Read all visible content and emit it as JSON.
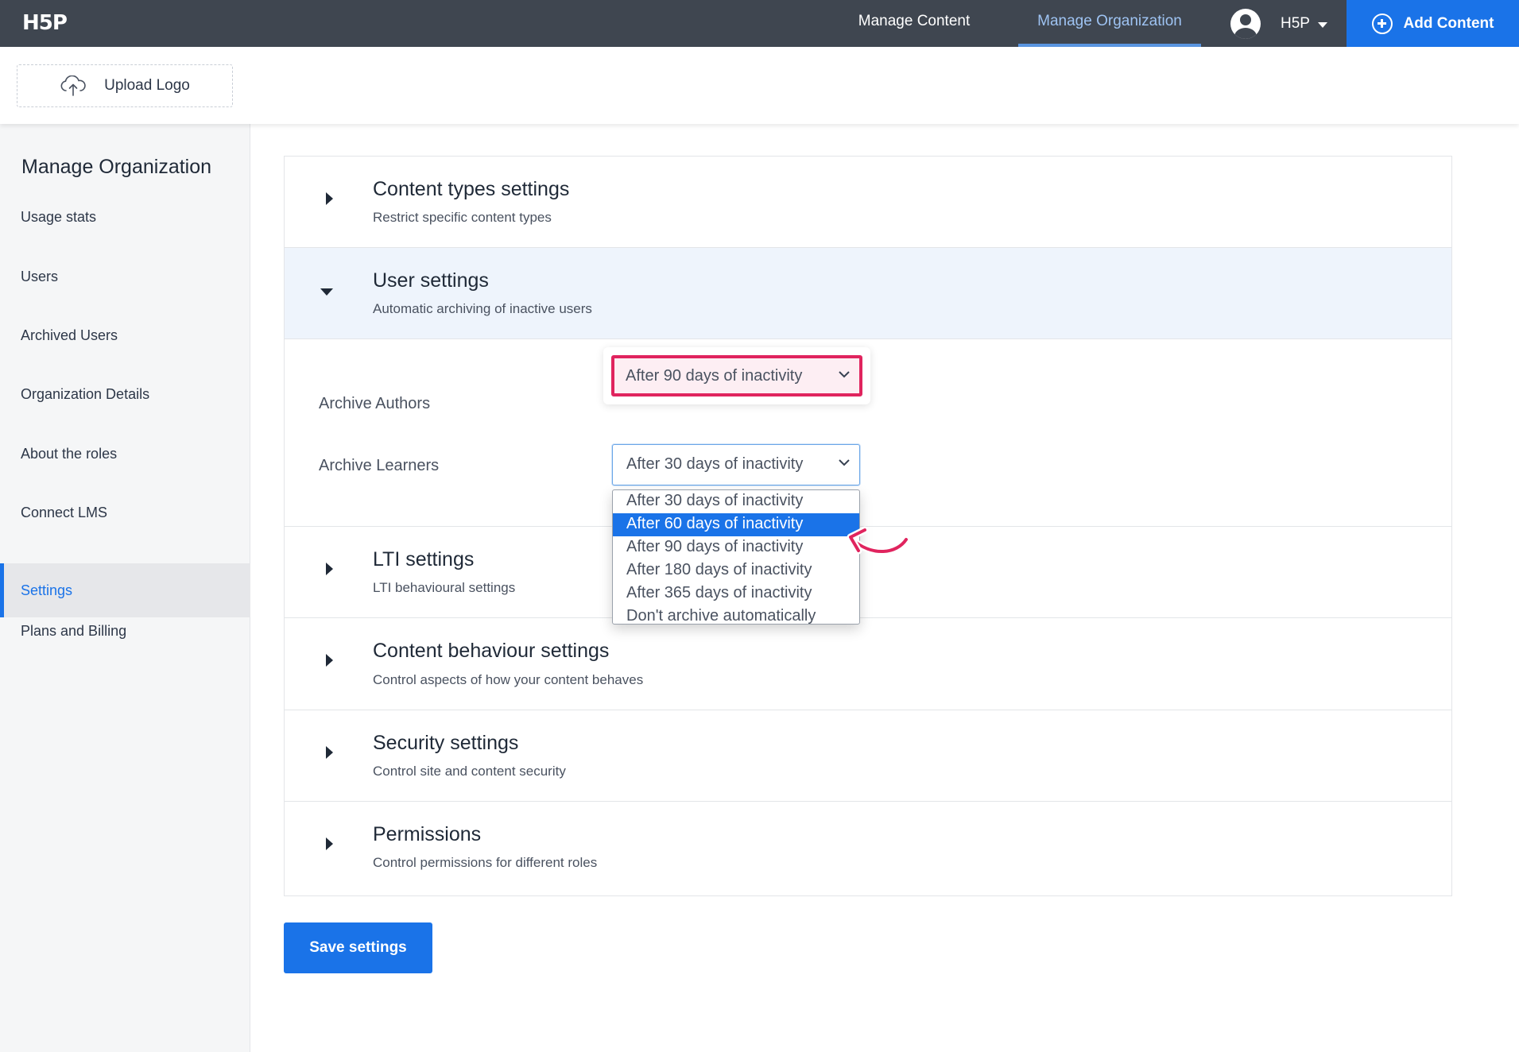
{
  "topbar": {
    "logo_text": "H5P",
    "nav": [
      {
        "label": "Manage Content",
        "active": false
      },
      {
        "label": "Manage Organization",
        "active": true
      }
    ],
    "user_name": "H5P",
    "add_content_label": "Add Content"
  },
  "header": {
    "upload_logo_label": "Upload Logo"
  },
  "sidebar": {
    "title": "Manage Organization",
    "items": [
      {
        "label": "Usage stats",
        "active": false
      },
      {
        "label": "Users",
        "active": false
      },
      {
        "label": "Archived Users",
        "active": false
      },
      {
        "label": "Organization Details",
        "active": false
      },
      {
        "label": "About the roles",
        "active": false
      },
      {
        "label": "Connect LMS",
        "active": false
      },
      {
        "label": "Settings",
        "active": true
      },
      {
        "label": "Plans and Billing",
        "active": false
      }
    ]
  },
  "sections": [
    {
      "title": "Content types settings",
      "subtitle": "Restrict specific content types",
      "expanded": false
    },
    {
      "title": "User settings",
      "subtitle": "Automatic archiving of inactive users",
      "expanded": true
    },
    {
      "title": "LTI settings",
      "subtitle": "LTI behavioural settings",
      "expanded": false
    },
    {
      "title": "Content behaviour settings",
      "subtitle": "Control aspects of how your content behaves",
      "expanded": false
    },
    {
      "title": "Security settings",
      "subtitle": "Control site and content security",
      "expanded": false
    },
    {
      "title": "Permissions",
      "subtitle": "Control permissions for different roles",
      "expanded": false
    }
  ],
  "user_settings": {
    "archive_authors": {
      "label": "Archive Authors",
      "value": "After 90 days of inactivity"
    },
    "archive_learners": {
      "label": "Archive Learners",
      "value": "After 30 days of inactivity"
    },
    "dropdown_options": [
      {
        "label": "After 30 days of inactivity",
        "highlighted": false
      },
      {
        "label": "After 60 days of inactivity",
        "highlighted": true
      },
      {
        "label": "After 90 days of inactivity",
        "highlighted": false
      },
      {
        "label": "After 180 days of inactivity",
        "highlighted": false
      },
      {
        "label": "After 365 days of inactivity",
        "highlighted": false
      },
      {
        "label": "Don't archive automatically",
        "highlighted": false
      }
    ]
  },
  "save_label": "Save settings",
  "colors": {
    "topbar_bg": "#3f4650",
    "accent_blue": "#1a73e8",
    "highlight_pink": "#e0245e",
    "active_nav": "#9ec3f2"
  }
}
